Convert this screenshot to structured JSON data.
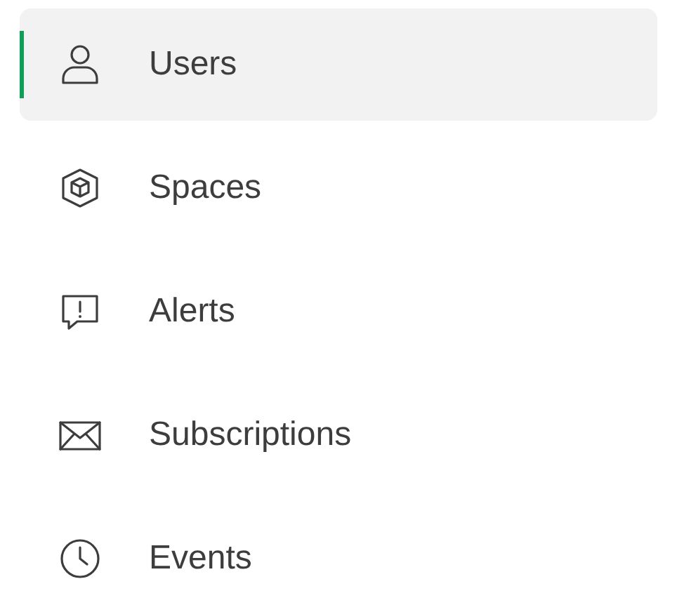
{
  "nav_items": [
    {
      "label": "Users",
      "selected": true
    },
    {
      "label": "Spaces",
      "selected": false
    },
    {
      "label": "Alerts",
      "selected": false
    },
    {
      "label": "Subscriptions",
      "selected": false
    },
    {
      "label": "Events",
      "selected": false
    }
  ]
}
